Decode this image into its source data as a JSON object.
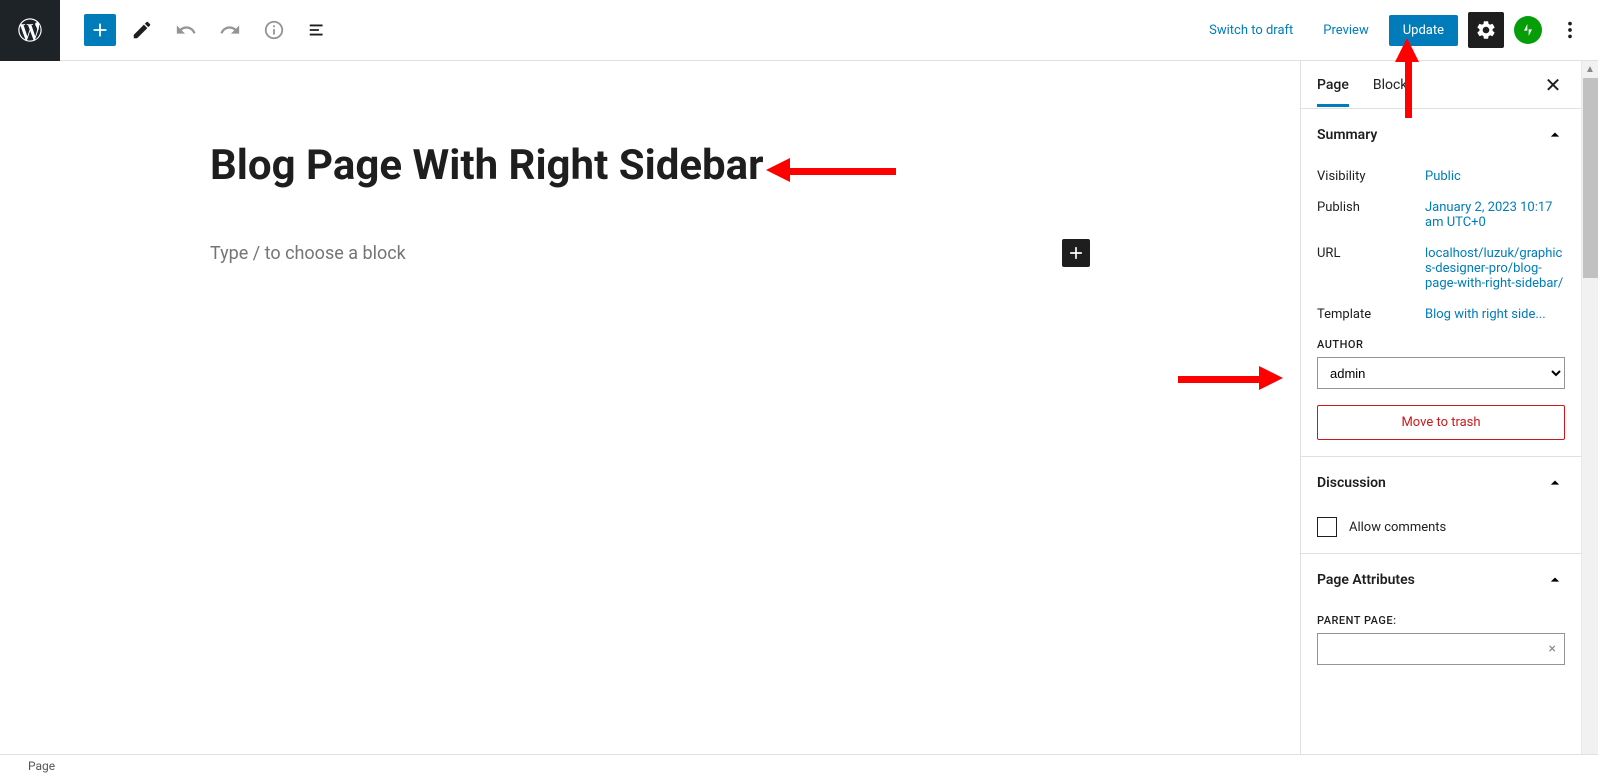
{
  "topbar": {
    "switch_draft": "Switch to draft",
    "preview": "Preview",
    "update": "Update"
  },
  "editor": {
    "title": "Blog Page With Right Sidebar",
    "block_prompt": "Type / to choose a block"
  },
  "sidebar": {
    "tabs": {
      "page": "Page",
      "block": "Block"
    },
    "summary": {
      "title": "Summary",
      "visibility_label": "Visibility",
      "visibility_value": "Public",
      "publish_label": "Publish",
      "publish_value": "January 2, 2023 10:17 am UTC+0",
      "url_label": "URL",
      "url_value": "localhost/luzuk/graphics-designer-pro/blog-page-with-right-sidebar/",
      "template_label": "Template",
      "template_value": "Blog with right side...",
      "author_label": "AUTHOR",
      "author_value": "admin",
      "trash": "Move to trash"
    },
    "discussion": {
      "title": "Discussion",
      "allow_comments": "Allow comments"
    },
    "page_attributes": {
      "title": "Page Attributes",
      "parent_label": "PARENT PAGE:"
    }
  },
  "footer": {
    "breadcrumb": "Page"
  }
}
